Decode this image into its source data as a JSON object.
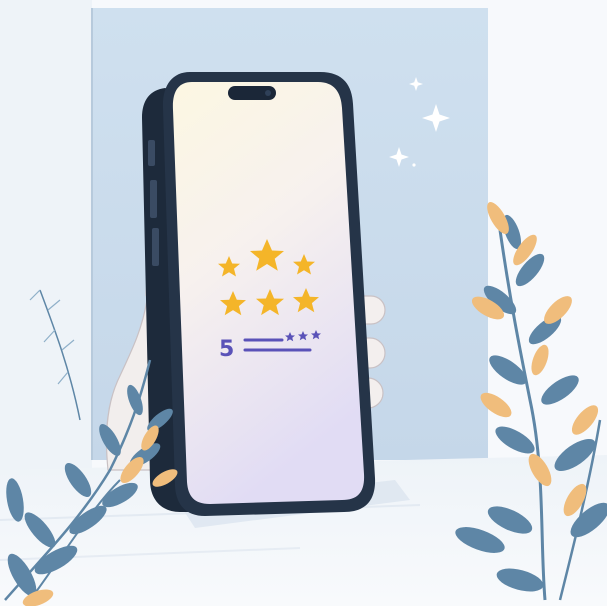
{
  "image": {
    "description_free": true
  },
  "phone_screen": {
    "rating": {
      "value": "5",
      "stars_filled": 6,
      "mini_stars": 3
    }
  },
  "colors": {
    "panel": "#cfe0ef",
    "wall": "#f7f9fc",
    "floor": "#f2f5f9",
    "phone_frame": "#253448",
    "screen_top": "#fbf6e3",
    "screen_bottom": "#e3def4",
    "star": "#f4b529",
    "rating_text": "#5a52b8",
    "leaf_blue": "#5e86a6",
    "leaf_orange": "#f0bd7c",
    "sparkle": "#ffffff"
  }
}
